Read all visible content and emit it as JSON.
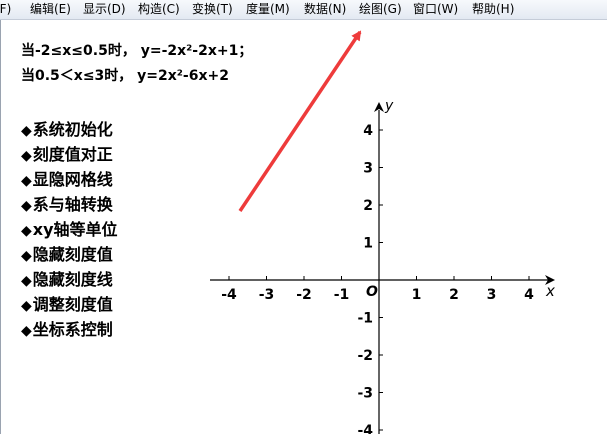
{
  "menubar": {
    "items": [
      "(F)",
      "编辑(E)",
      "显示(D)",
      "构造(C)",
      "变换(T)",
      "度量(M)",
      "数据(N)",
      "绘图(G)",
      "窗口(W)",
      "帮助(H)"
    ]
  },
  "formulas": {
    "line1": "当-2≤x≤0.5时， y=-2x²-2x+1；",
    "line2": "当0.5＜x≤3时， y=2x²-6x+2"
  },
  "buttons": {
    "diamond": "◆",
    "labels": [
      "系统初始化",
      "刻度值对正",
      "显隐网格线",
      "系与轴转换",
      "xy轴等单位",
      "隐藏刻度值",
      "隐藏刻度线",
      "调整刻度值",
      "坐标系控制"
    ]
  },
  "axes": {
    "x_label": "x",
    "y_label": "y",
    "origin_label": "O",
    "x_ticks": [
      "-4",
      "-3",
      "-2",
      "-1",
      "1",
      "2",
      "3",
      "4"
    ],
    "y_ticks": [
      "4",
      "3",
      "2",
      "1",
      "-1",
      "-2",
      "-3",
      "-4"
    ]
  },
  "colors": {
    "arrow": "#ee3b3b",
    "axis": "#000000"
  }
}
